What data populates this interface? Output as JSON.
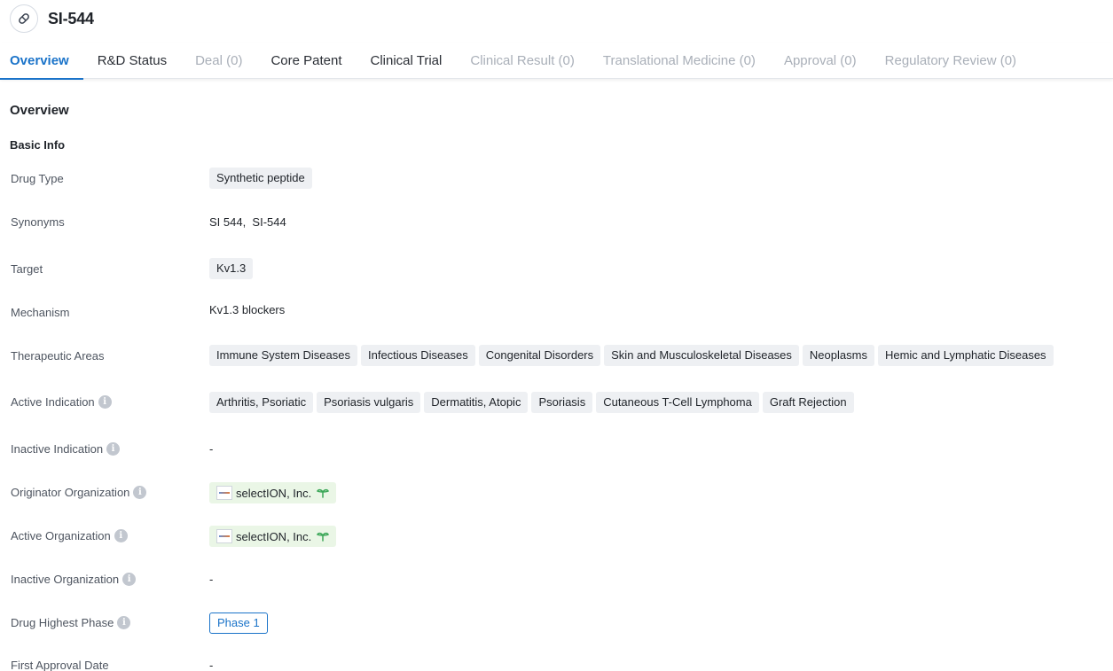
{
  "drug": {
    "name": "SI-544",
    "icon": "pill-icon"
  },
  "tabs": [
    {
      "label": "Overview",
      "state": "active"
    },
    {
      "label": "R&D Status",
      "state": "enabled"
    },
    {
      "label": "Deal (0)",
      "state": "disabled"
    },
    {
      "label": "Core Patent",
      "state": "enabled"
    },
    {
      "label": "Clinical Trial",
      "state": "enabled"
    },
    {
      "label": "Clinical Result (0)",
      "state": "disabled"
    },
    {
      "label": "Translational Medicine (0)",
      "state": "disabled"
    },
    {
      "label": "Approval (0)",
      "state": "disabled"
    },
    {
      "label": "Regulatory Review (0)",
      "state": "disabled"
    }
  ],
  "overview": {
    "title": "Overview",
    "basic_info": "Basic Info",
    "fields": {
      "drug_type": {
        "label": "Drug Type",
        "tags": [
          "Synthetic peptide"
        ]
      },
      "synonyms": {
        "label": "Synonyms",
        "text": "SI 544,  SI-544"
      },
      "target": {
        "label": "Target",
        "tags": [
          "Kv1.3"
        ]
      },
      "mechanism": {
        "label": "Mechanism",
        "text": "Kv1.3 blockers"
      },
      "therapeutic_areas": {
        "label": "Therapeutic Areas",
        "tags": [
          "Immune System Diseases",
          "Infectious Diseases",
          "Congenital Disorders",
          "Skin and Musculoskeletal Diseases",
          "Neoplasms",
          "Hemic and Lymphatic Diseases"
        ]
      },
      "active_indication": {
        "label": "Active Indication",
        "tags": [
          "Arthritis, Psoriatic",
          "Psoriasis vulgaris",
          "Dermatitis, Atopic",
          "Psoriasis",
          "Cutaneous T-Cell Lymphoma",
          "Graft Rejection"
        ]
      },
      "inactive_indication": {
        "label": "Inactive Indication",
        "text": "-"
      },
      "originator_org": {
        "label": "Originator Organization",
        "org": "selectION, Inc."
      },
      "active_org": {
        "label": "Active Organization",
        "org": "selectION, Inc."
      },
      "inactive_org": {
        "label": "Inactive Organization",
        "text": "-"
      },
      "highest_phase": {
        "label": "Drug Highest Phase",
        "phase": "Phase 1"
      },
      "first_approval": {
        "label": "First Approval Date",
        "text": "-"
      }
    }
  },
  "colors": {
    "accent": "#1a73c9",
    "tag_bg": "#eef0f3",
    "org_bg": "#eaf6e6",
    "sprout": "#3aa657"
  }
}
